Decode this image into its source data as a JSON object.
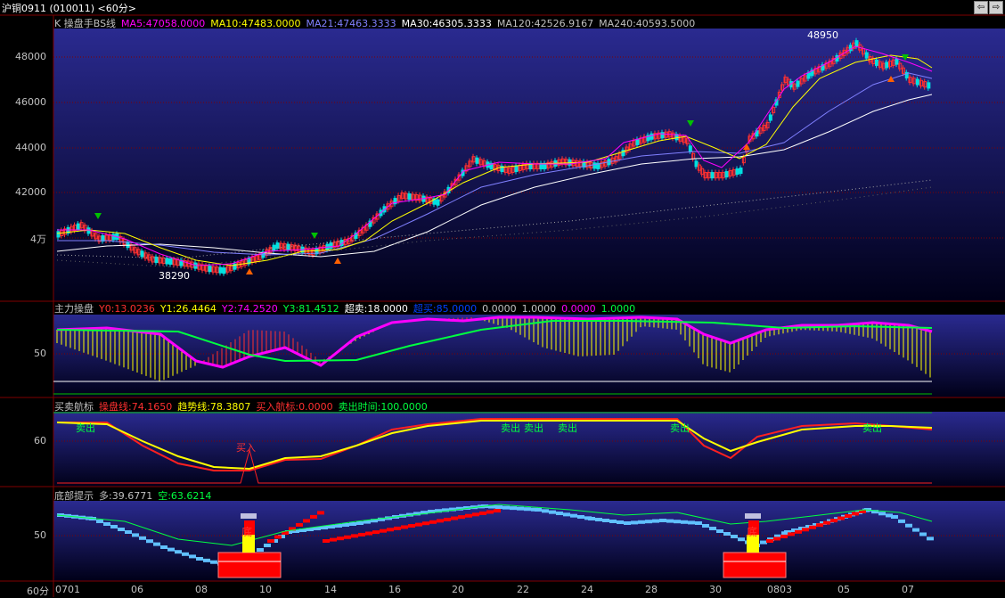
{
  "title": "沪铜0911 (010011) <60分>",
  "window_buttons": {
    "prev": "⇦",
    "next": "⇨"
  },
  "panel1": {
    "name": "K 操盘手BS线",
    "ma5": "MA5:47058.0000",
    "ma10": "MA10:47483.0000",
    "ma21": "MA21:47463.3333",
    "ma30": "MA30:46305.3333",
    "ma120": "MA120:42526.9167",
    "ma240": "MA240:40593.5000",
    "y_ticks": [
      "48000",
      "46000",
      "44000",
      "42000",
      "4万"
    ],
    "high_label": "48950",
    "low_label": "38290"
  },
  "panel2": {
    "name": "主力操盘",
    "y0": "Y0:13.0236",
    "y1": "Y1:26.4464",
    "y2": "Y2:74.2520",
    "y3": "Y3:81.4512",
    "overbuy": "超卖:18.0000",
    "oversell": "超买:85.0000",
    "v1": "0.0000",
    "v2": "1.0000",
    "v3": "0.0000",
    "v4": "1.0000",
    "y_tick": "50"
  },
  "panel3": {
    "name": "买卖航标",
    "line1": "操盘线:74.1650",
    "line2": "趋势线:78.3807",
    "line3": "买入航标:0.0000",
    "line4": "卖出时间:100.0000",
    "y_tick": "60",
    "buy_label": "买入",
    "sell_label": "卖出"
  },
  "panel4": {
    "name": "底部提示",
    "long": "多:39.6771",
    "short": "空:63.6214",
    "y_tick": "50",
    "bottom_label": "底"
  },
  "x_axis": {
    "period": "60分",
    "labels": [
      "0701",
      "06",
      "08",
      "10",
      "14",
      "16",
      "20",
      "22",
      "24",
      "28",
      "30",
      "0803",
      "05",
      "07"
    ]
  },
  "colors": {
    "ma5": "#ff00ff",
    "ma10": "#ffff00",
    "ma21": "#8080ff",
    "ma30": "#ffffff",
    "up": "#ff3030",
    "down": "#00e0e0",
    "grid": "#800000"
  }
}
